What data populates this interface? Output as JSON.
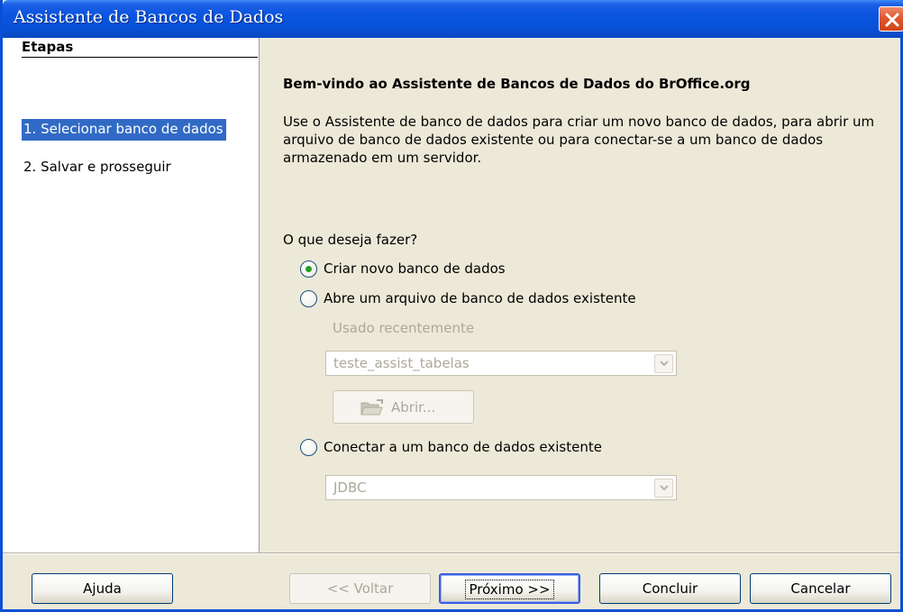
{
  "window": {
    "title": "Assistente de Bancos de Dados"
  },
  "steps": {
    "heading": "Etapas",
    "items": [
      {
        "label": "1. Selecionar banco de dados",
        "active": true
      },
      {
        "label": "2. Salvar e prosseguir",
        "active": false
      }
    ]
  },
  "main": {
    "title": "Bem-vindo ao Assistente de Bancos de Dados do BrOffice.org",
    "intro": "Use o Assistente de banco de dados para criar um novo banco de dados, para abrir um arquivo de banco de dados existente ou para conectar-se a um banco de dados armazenado em um servidor.",
    "question": "O que deseja fazer?",
    "options": [
      {
        "label": "Criar novo banco de dados",
        "selected": true
      },
      {
        "label": "Abre um arquivo de banco de dados existente",
        "selected": false
      },
      {
        "label": "Conectar a um banco de dados existente",
        "selected": false
      }
    ],
    "recent_label": "Usado recentemente",
    "recent_value": "teste_assist_tabelas",
    "open_button": "Abrir...",
    "connection_value": "JDBC"
  },
  "buttons": {
    "help": "Ajuda",
    "back": "<< Voltar",
    "next": "Próximo >>",
    "finish": "Concluir",
    "cancel": "Cancelar"
  },
  "colors": {
    "titlebar": "#0a55e0",
    "selection": "#316ac5",
    "close": "#e0582e"
  }
}
